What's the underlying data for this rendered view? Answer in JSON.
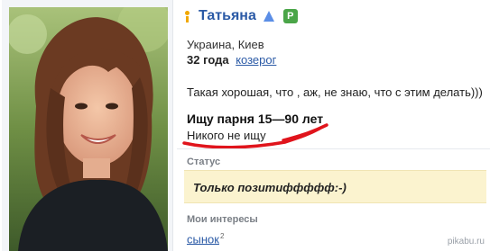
{
  "profile": {
    "name": "Татьяна",
    "badge_letter": "P",
    "location": "Украина, Киев",
    "age": "32 года",
    "zodiac": "козерог",
    "about": "Такая хорошая, что , аж, не знаю, что с этим делать)))",
    "seeking_title": "Ищу парня 15—90 лет",
    "seeking_value": "Никого не ищу"
  },
  "status": {
    "label": "Статус",
    "text": "Только позитиффффф:-)"
  },
  "interests": {
    "label": "Мои интересы",
    "items": [
      {
        "label": "сынок",
        "count": "2"
      }
    ]
  },
  "watermark": "pikabu.ru",
  "colors": {
    "name_link": "#2b5aa6",
    "status_bg": "#fbf3cf",
    "online_indicator": "#f1a800",
    "badge_green": "#4aa548",
    "red_underline": "#e0141c"
  },
  "icons": {
    "online": "person-status-icon",
    "direction": "triangle-up-icon",
    "badge": "p-badge-icon"
  }
}
